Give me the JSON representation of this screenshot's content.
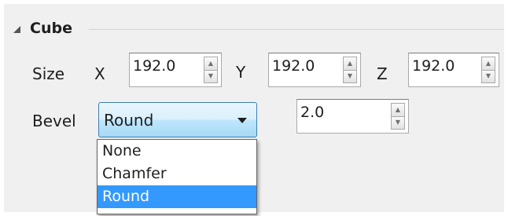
{
  "group": {
    "title": "Cube"
  },
  "size": {
    "label": "Size",
    "x": {
      "label": "X",
      "value": "192.0"
    },
    "y": {
      "label": "Y",
      "value": "192.0"
    },
    "z": {
      "label": "Z",
      "value": "192.0"
    }
  },
  "bevel": {
    "label": "Bevel",
    "selected": "Round",
    "options": [
      "None",
      "Chamfer",
      "Round"
    ],
    "highlighted_option": "Round",
    "amount": "2.0"
  },
  "icons": {
    "collapse": "collapse-arrow-icon",
    "spin_up": "spin-up-icon",
    "spin_down": "spin-down-icon",
    "dropdown": "chevron-down-icon"
  },
  "colors": {
    "panel_bg": "#f0f0f0",
    "selection": "#3399ff",
    "combo_border": "#3c7fb1"
  }
}
